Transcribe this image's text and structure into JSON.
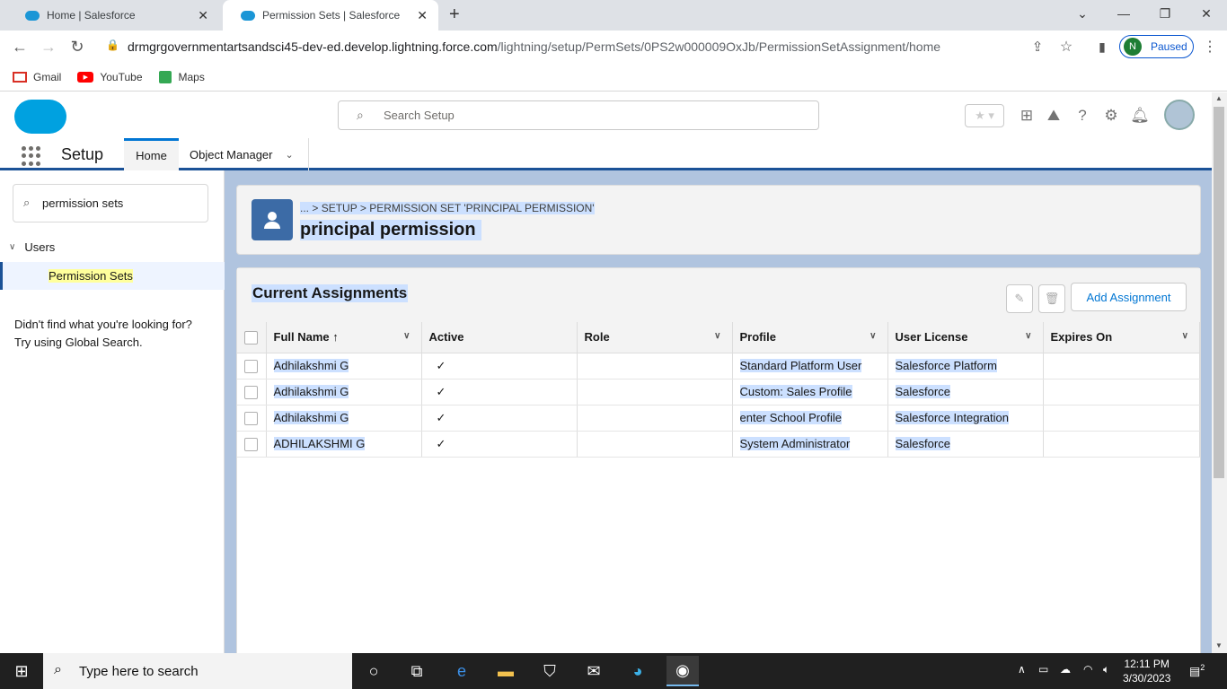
{
  "browser": {
    "tabs": [
      {
        "label": "Home | Salesforce"
      },
      {
        "label": "Permission Sets | Salesforce"
      }
    ],
    "url_host": "drmgrgovernmentartsandsci45-dev-ed.develop.lightning.force.com",
    "url_path": "/lightning/setup/PermSets/0PS2w000009OxJb/PermissionSetAssignment/home",
    "profile_initial": "N",
    "profile_status": "Paused",
    "bookmarks": [
      "Gmail",
      "YouTube",
      "Maps"
    ]
  },
  "header": {
    "search_placeholder": "Search Setup"
  },
  "nav": {
    "title": "Setup",
    "home": "Home",
    "object_manager": "Object Manager"
  },
  "sidebar": {
    "quick_find_value": "permission sets",
    "group": "Users",
    "item": "Permission Sets",
    "help_line1": "Didn't find what you're looking for?",
    "help_line2": "Try using Global Search."
  },
  "page": {
    "breadcrumb_more": "...",
    "breadcrumb_setup": "SETUP",
    "breadcrumb_current": "PERMISSION SET 'PRINCIPAL PERMISSION'",
    "title": "principal permission"
  },
  "assignments": {
    "title": "Current Assignments",
    "add_button": "Add Assignment",
    "columns": [
      "Full Name",
      "Active",
      "Role",
      "Profile",
      "User License",
      "Expires On"
    ],
    "rows": [
      {
        "name": "Adhilakshmi G",
        "active": "✓",
        "role": "",
        "profile": "Standard Platform User",
        "license": "Salesforce Platform",
        "expires": ""
      },
      {
        "name": "Adhilakshmi G",
        "active": "✓",
        "role": "",
        "profile": "Custom: Sales Profile",
        "license": "Salesforce",
        "expires": ""
      },
      {
        "name": "Adhilakshmi G",
        "active": "✓",
        "role": "",
        "profile": "enter School Profile",
        "license": "Salesforce Integration",
        "expires": ""
      },
      {
        "name": "ADHILAKSHMI G",
        "active": "✓",
        "role": "",
        "profile": "System Administrator",
        "license": "Salesforce",
        "expires": ""
      }
    ]
  },
  "taskbar": {
    "search_placeholder": "Type here to search",
    "time": "12:11 PM",
    "date": "3/30/2023",
    "notifications": "2"
  }
}
